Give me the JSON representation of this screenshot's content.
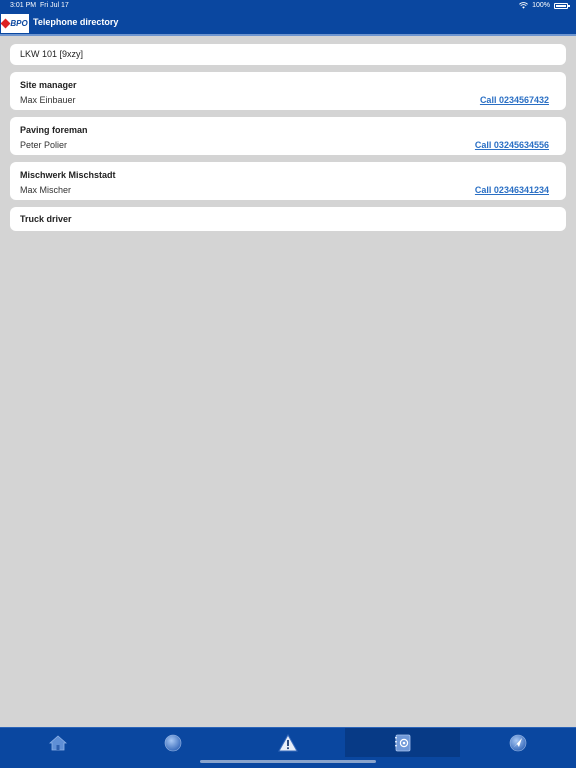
{
  "status": {
    "time": "3:01 PM",
    "date": "Fri Jul 17",
    "battery": "100%"
  },
  "header": {
    "logo_text": "BPO",
    "title": "Telephone directory"
  },
  "vehicle": {
    "label": "LKW 101 [9xzy]"
  },
  "contacts": [
    {
      "role": "Site manager",
      "name": "Max Einbauer",
      "call": "Call 0234567432"
    },
    {
      "role": "Paving foreman",
      "name": "Peter Polier",
      "call": "Call 03245634556"
    },
    {
      "role": "Mischwerk Mischstadt",
      "name": "Max Mischer",
      "call": "Call 02346341234"
    }
  ],
  "truck": {
    "role": "Truck driver"
  },
  "tabs": [
    {
      "icon": "home-icon"
    },
    {
      "icon": "globe-icon"
    },
    {
      "icon": "warning-icon"
    },
    {
      "icon": "phonebook-icon",
      "active": true
    },
    {
      "icon": "navigation-icon"
    }
  ],
  "colors": {
    "primary": "#0a47a0",
    "background": "#d4d4d4",
    "link": "#2a6fc4"
  }
}
